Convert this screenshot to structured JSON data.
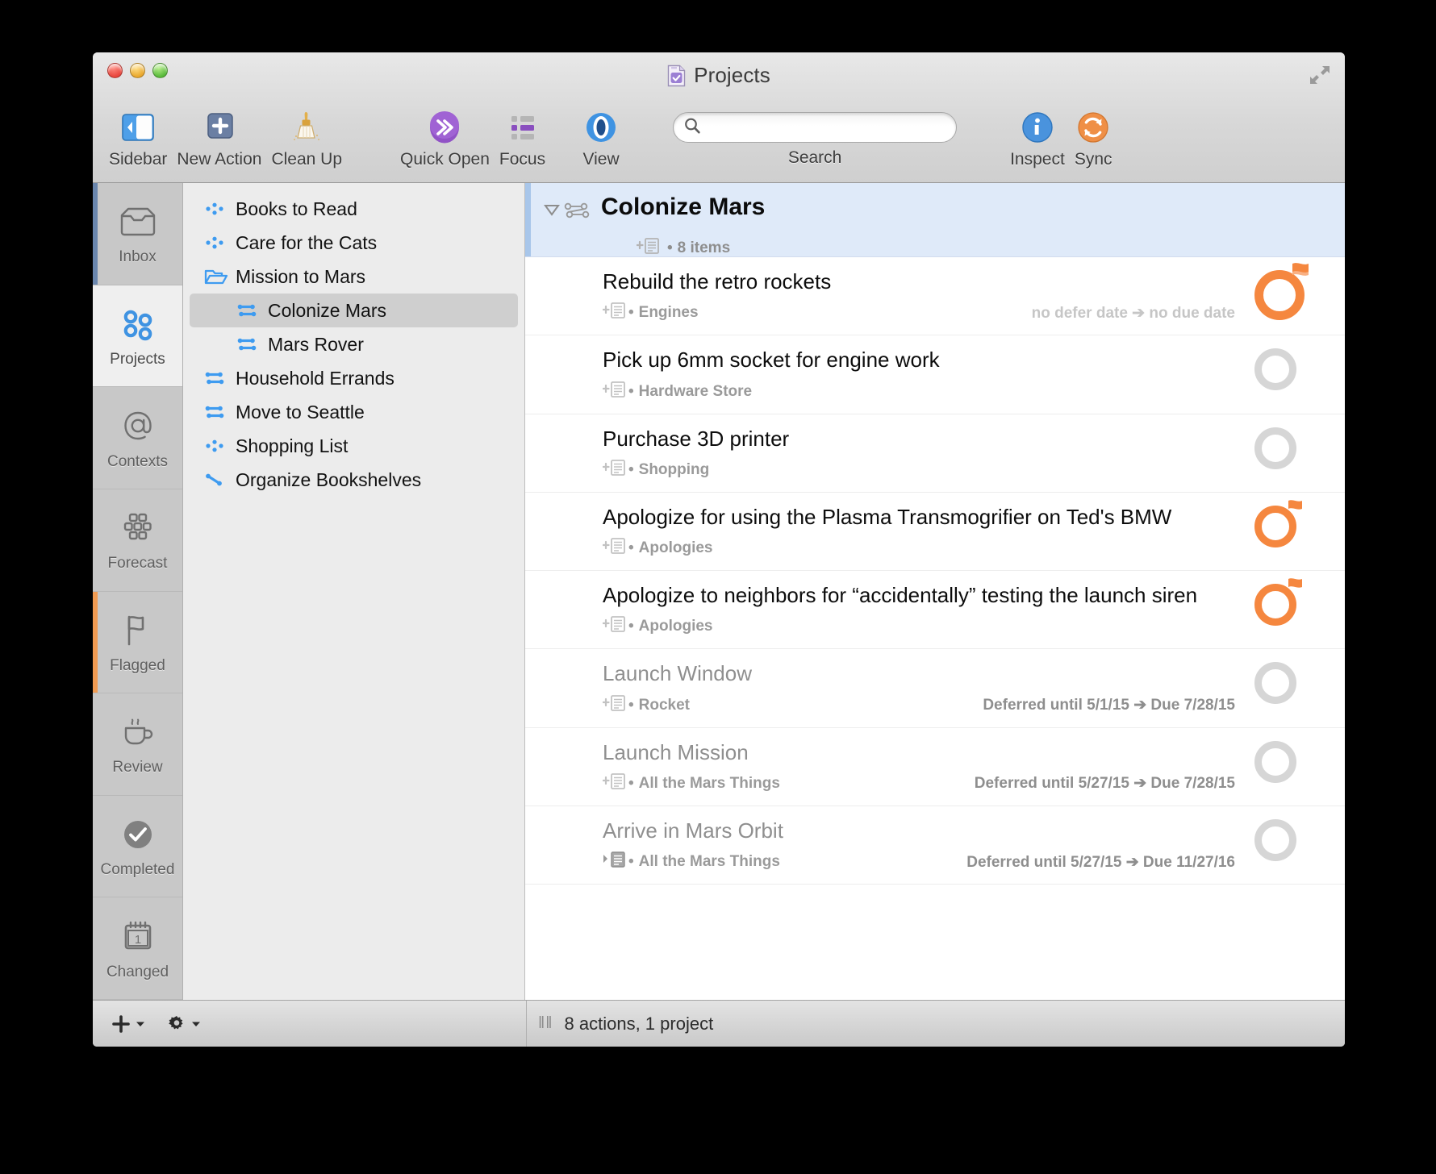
{
  "window": {
    "title": "Projects",
    "doc_icon": "document-checkbox-icon",
    "fullscreen_icon": "fullscreen-icon",
    "traffic_lights": [
      "close-button",
      "minimize-button",
      "zoom-button"
    ]
  },
  "toolbar": {
    "items": [
      {
        "id": "sidebar",
        "label": "Sidebar",
        "icon": "sidebar-toggle-icon"
      },
      {
        "id": "new-action",
        "label": "New Action",
        "icon": "plus-square-icon"
      },
      {
        "id": "clean-up",
        "label": "Clean Up",
        "icon": "broom-icon"
      },
      {
        "id": "quick-open",
        "label": "Quick Open",
        "icon": "arrow-circle-icon"
      },
      {
        "id": "focus",
        "label": "Focus",
        "icon": "list-focus-icon"
      },
      {
        "id": "view",
        "label": "View",
        "icon": "eye-icon"
      },
      {
        "id": "inspect",
        "label": "Inspect",
        "icon": "info-circle-icon"
      },
      {
        "id": "sync",
        "label": "Sync",
        "icon": "sync-circle-icon"
      }
    ],
    "search": {
      "label": "Search",
      "value": "",
      "placeholder": "",
      "icon": "search-icon"
    }
  },
  "rail": {
    "items": [
      {
        "id": "inbox",
        "label": "Inbox",
        "icon": "inbox-icon",
        "selected": false,
        "marker": "blue"
      },
      {
        "id": "projects",
        "label": "Projects",
        "icon": "projects-icon",
        "selected": true,
        "marker": "none"
      },
      {
        "id": "contexts",
        "label": "Contexts",
        "icon": "at-icon",
        "selected": false,
        "marker": "none"
      },
      {
        "id": "forecast",
        "label": "Forecast",
        "icon": "calendar-grid-icon",
        "selected": false,
        "marker": "none"
      },
      {
        "id": "flagged",
        "label": "Flagged",
        "icon": "flag-icon",
        "selected": false,
        "marker": "orange"
      },
      {
        "id": "review",
        "label": "Review",
        "icon": "coffee-cup-icon",
        "selected": false,
        "marker": "none"
      },
      {
        "id": "completed",
        "label": "Completed",
        "icon": "check-circle-icon",
        "selected": false,
        "marker": "none"
      },
      {
        "id": "changed",
        "label": "Changed",
        "icon": "calendar-one-icon",
        "selected": false,
        "marker": "none"
      }
    ]
  },
  "projects": {
    "items": [
      {
        "id": "books-to-read",
        "label": "Books to Read",
        "icon": "parallel-project-icon",
        "indent": 0,
        "selected": false
      },
      {
        "id": "care-for-the-cats",
        "label": "Care for the Cats",
        "icon": "parallel-project-icon",
        "indent": 0,
        "selected": false
      },
      {
        "id": "mission-to-mars",
        "label": "Mission to Mars",
        "icon": "folder-open-icon",
        "indent": 0,
        "selected": false
      },
      {
        "id": "colonize-mars",
        "label": "Colonize Mars",
        "icon": "sequential-project-icon",
        "indent": 1,
        "selected": true
      },
      {
        "id": "mars-rover",
        "label": "Mars Rover",
        "icon": "sequential-project-icon",
        "indent": 1,
        "selected": false
      },
      {
        "id": "household-errands",
        "label": "Household Errands",
        "icon": "sequential-project-icon",
        "indent": 0,
        "selected": false
      },
      {
        "id": "move-to-seattle",
        "label": "Move to Seattle",
        "icon": "sequential-project-icon",
        "indent": 0,
        "selected": false
      },
      {
        "id": "shopping-list",
        "label": "Shopping List",
        "icon": "parallel-project-icon",
        "indent": 0,
        "selected": false
      },
      {
        "id": "organize-bookshelves",
        "label": "Organize Bookshelves",
        "icon": "single-action-list-icon",
        "indent": 0,
        "selected": false
      }
    ]
  },
  "content": {
    "group_header": {
      "title": "Colonize Mars",
      "item_count": "8 items",
      "separator": "•",
      "disclosure_icon": "disclosure-triangle-down-icon",
      "project_icon": "sequential-project-icon",
      "note_icon": "add-note-icon"
    },
    "tasks": [
      {
        "id": "rebuild-the-retro-rockets",
        "title": "Rebuild the retro rockets",
        "context": "Engines",
        "dates": "no defer date ➔ no due date",
        "dates_state": "none",
        "note_icon": "add-note-icon",
        "separator": "•",
        "status": "flagged",
        "deferred": false
      },
      {
        "id": "pick-up-6mm-socket-for-engine-work",
        "title": "Pick up 6mm socket for engine work",
        "context": "Hardware Store",
        "dates": "",
        "dates_state": "none",
        "note_icon": "add-note-icon",
        "separator": "•",
        "status": "normal",
        "deferred": false
      },
      {
        "id": "purchase-3d-printer",
        "title": "Purchase 3D printer",
        "context": "Shopping",
        "dates": "",
        "dates_state": "none",
        "note_icon": "add-note-icon",
        "separator": "•",
        "status": "normal",
        "deferred": false
      },
      {
        "id": "apologize-plasma-transmogrifier",
        "title": "Apologize for using the Plasma Transmogrifier on Ted's BMW",
        "context": "Apologies",
        "dates": "",
        "dates_state": "none",
        "note_icon": "add-note-icon",
        "separator": "•",
        "status": "flagged",
        "deferred": false
      },
      {
        "id": "apologize-neighbors-launch-siren",
        "title": "Apologize to neighbors for “accidentally” testing the launch siren",
        "context": "Apologies",
        "dates": "",
        "dates_state": "none",
        "note_icon": "add-note-icon",
        "separator": "•",
        "status": "flagged",
        "deferred": false
      },
      {
        "id": "launch-window",
        "title": "Launch Window",
        "context": "Rocket",
        "dates": "Deferred until 5/1/15 ➔ Due 7/28/15",
        "dates_state": "set",
        "note_icon": "add-note-icon",
        "separator": "•",
        "status": "normal",
        "deferred": true
      },
      {
        "id": "launch-mission",
        "title": "Launch Mission",
        "context": "All the Mars Things",
        "dates": "Deferred until 5/27/15 ➔ Due 7/28/15",
        "dates_state": "set",
        "note_icon": "add-note-icon",
        "separator": "•",
        "status": "normal",
        "deferred": true
      },
      {
        "id": "arrive-in-mars-orbit",
        "title": "Arrive in Mars Orbit",
        "context": "All the Mars Things",
        "dates": "Deferred until 5/27/15 ➔ Due 11/27/16",
        "dates_state": "set",
        "note_icon": "collapsed-note-icon",
        "separator": "•",
        "status": "normal",
        "deferred": true
      }
    ]
  },
  "statusbar": {
    "add_button": {
      "icon": "plus-icon",
      "label": ""
    },
    "action_button": {
      "icon": "gear-icon",
      "label": ""
    },
    "grip": "‖‖",
    "status_text": "8 actions, 1 project"
  },
  "colors": {
    "accent_blue": "#3e9bf0",
    "flag_orange": "#f5873f",
    "selection_blue": "#dfeaf9",
    "sidebar_selection": "#cfcfcf"
  },
  "cursor": {
    "icon": "mouse-pointer-icon"
  }
}
